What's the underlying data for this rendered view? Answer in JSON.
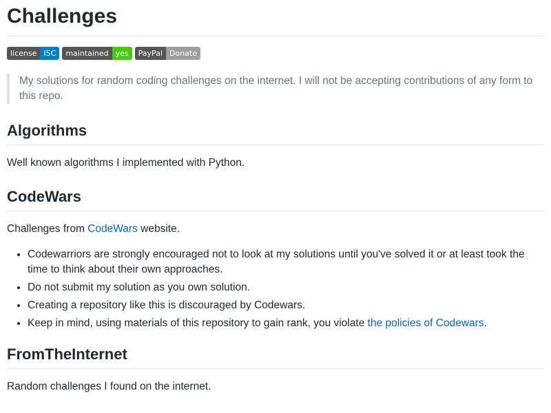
{
  "title": "Challenges",
  "badges": [
    {
      "left": "license",
      "right": "ISC",
      "color": "#007ec6"
    },
    {
      "left": "maintained",
      "right": "yes",
      "color": "#4c1"
    },
    {
      "left": "PayPal",
      "right": "Donate",
      "color": "#9f9f9f"
    }
  ],
  "intro": "My solutions for random coding challenges on the internet. I will not be accepting contributions of any form to this repo.",
  "sections": {
    "algorithms": {
      "heading": "Algorithms",
      "text": "Well known algorithms I implemented with Python."
    },
    "codewars": {
      "heading": "CodeWars",
      "text_before": "Challenges from ",
      "link": "CodeWars",
      "text_after": " website.",
      "bullets": [
        "Codewarriors are strongly encouraged not to look at my solutions until you've solved it or at least took the time to think about their own approaches.",
        "Do not submit my solution as you own solution.",
        "Creating a repository like this is discouraged by Codewars."
      ],
      "last_bullet_before": "Keep in mind, using materials of this repository to gain rank, you violate ",
      "last_bullet_link": "the policies of Codewars",
      "last_bullet_after": "."
    },
    "internet": {
      "heading": "FromTheInternet",
      "text": "Random challenges I found on the internet."
    }
  },
  "colors": {
    "link": "#0366d6",
    "text": "#24292e",
    "quote": "#6a737d"
  }
}
